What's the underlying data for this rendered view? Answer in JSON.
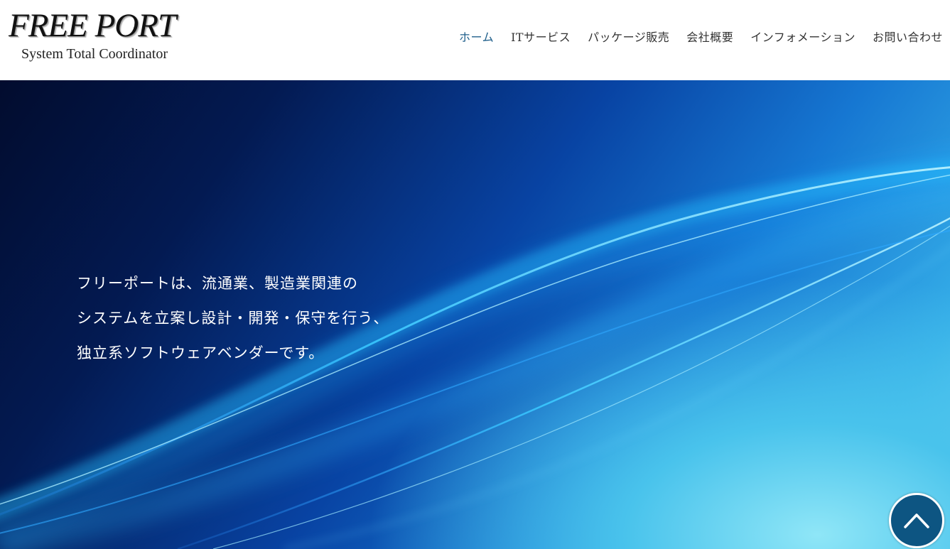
{
  "logo": {
    "name": "FREE PORT",
    "subtitle": "System Total Coordinator"
  },
  "nav": {
    "items": [
      {
        "label": "ホーム",
        "active": true
      },
      {
        "label": "ITサービス",
        "active": false
      },
      {
        "label": "パッケージ販売",
        "active": false
      },
      {
        "label": "会社概要",
        "active": false
      },
      {
        "label": "インフォメーション",
        "active": false
      },
      {
        "label": "お問い合わせ",
        "active": false
      }
    ]
  },
  "hero": {
    "lines": [
      "フリーポートは、流通業、製造業関連の",
      "システムを立案し設計・開発・保守を行う、",
      "独立系ソフトウェアベンダーです。"
    ]
  },
  "scroll_top": {
    "icon": "chevron-up-icon"
  },
  "colors": {
    "nav_active": "#1f5f8b",
    "nav_text": "#333333",
    "scroll_button": "#0d5582"
  }
}
